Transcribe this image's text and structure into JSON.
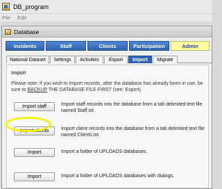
{
  "app": {
    "title": "DB_program"
  },
  "menu": {
    "file": "File",
    "edit": "Edit"
  },
  "window": {
    "title": "Database"
  },
  "main_tabs": [
    {
      "label": "Incidents",
      "active": false
    },
    {
      "label": "Staff",
      "active": false
    },
    {
      "label": "Clients",
      "active": false
    },
    {
      "label": "Participation",
      "active": false
    },
    {
      "label": "Admin",
      "active": true
    }
  ],
  "sub_tabs": [
    {
      "label": "National Dataset",
      "active": false
    },
    {
      "label": "Settings",
      "active": false
    },
    {
      "label": "Activities",
      "active": false
    },
    {
      "label": "Export",
      "active": false
    },
    {
      "label": "Import",
      "active": true
    },
    {
      "label": "Migrate",
      "active": false
    }
  ],
  "import_panel": {
    "title": "Import",
    "note_part1": "Please note: If you wish to import records, after the database has already been in use, be sure to ",
    "note_link": "BACKUP",
    "note_part2": " THE DATABASE FILE FIRST (see: Export).",
    "actions": [
      {
        "button": "Import staff",
        "description": "Import staff records into the database from a tab delimited text file named Staff.txt."
      },
      {
        "button": "Import clients",
        "description": "Import client records into the database from a tab delimited text file named Clients.txt."
      },
      {
        "button": "Import",
        "description": "Import a folder of UPLOADS databases."
      },
      {
        "button": "Import",
        "description": "Import a folder of UPLOADS databases with dialogs."
      }
    ]
  },
  "colors": {
    "tab_blue": "#2e63b1",
    "tab_active": "#ffff9f",
    "highlight": "#f4f40a"
  }
}
